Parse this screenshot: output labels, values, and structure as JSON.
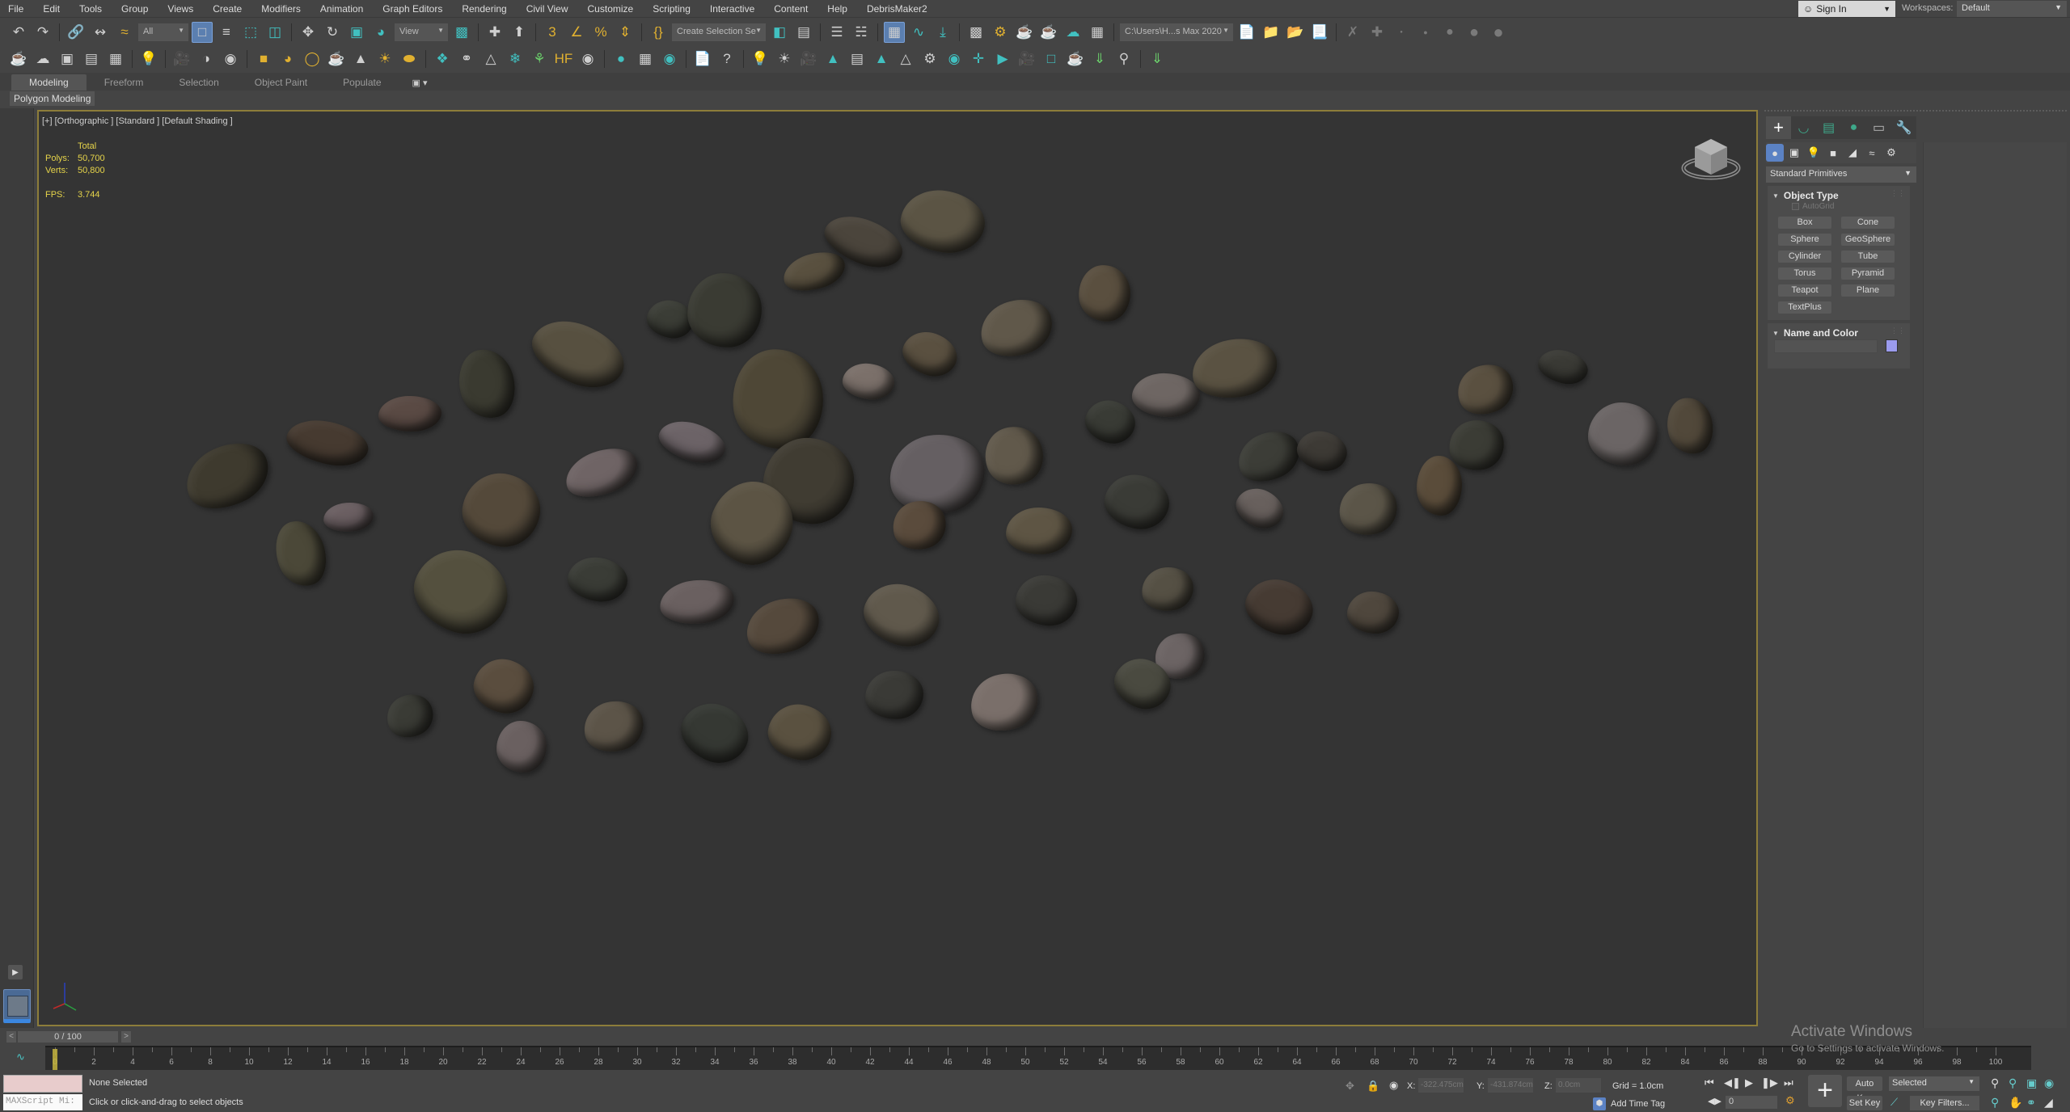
{
  "menubar": {
    "items": [
      "File",
      "Edit",
      "Tools",
      "Group",
      "Views",
      "Create",
      "Modifiers",
      "Animation",
      "Graph Editors",
      "Rendering",
      "Civil View",
      "Customize",
      "Scripting",
      "Interactive",
      "Content",
      "Help",
      "DebrisMaker2"
    ],
    "sign_in": "Sign In",
    "workspaces_label": "Workspaces:",
    "workspace_value": "Default"
  },
  "toolbar": {
    "selection_filter": "All",
    "ref_coord": "View",
    "named_selection": "Create Selection Se",
    "project_path": "C:\\Users\\H...s Max 2020"
  },
  "ribbon": {
    "tabs": [
      "Modeling",
      "Freeform",
      "Selection",
      "Object Paint",
      "Populate"
    ],
    "active_tab": "Modeling",
    "sub_panel": "Polygon Modeling"
  },
  "viewport": {
    "label": "[+] [Orthographic ] [Standard ] [Default Shading ]",
    "stats": {
      "header": "Total",
      "polys_label": "Polys:",
      "polys": "50,700",
      "verts_label": "Verts:",
      "verts": "50,800",
      "fps_label": "FPS:",
      "fps": "3.744"
    },
    "colors": {
      "frame": "#8d7d3a",
      "stats": "#e6d44a"
    }
  },
  "command_panel": {
    "category": "Standard Primitives",
    "object_type": {
      "title": "Object Type",
      "autogrid": "AutoGrid",
      "buttons": [
        "Box",
        "Cone",
        "Sphere",
        "GeoSphere",
        "Cylinder",
        "Tube",
        "Torus",
        "Pyramid",
        "Teapot",
        "Plane",
        "TextPlus"
      ]
    },
    "name_color": {
      "title": "Name and Color",
      "name_value": "",
      "swatch_color": "#9b9bee"
    }
  },
  "timeline": {
    "slider_text": "0 / 100",
    "current_frame": 0,
    "start": 0,
    "end": 100,
    "label_step": 2
  },
  "statusbar": {
    "maxscript_placeholder": "MAXScript Mi:",
    "selection_status": "None Selected",
    "prompt": "Click or click-and-drag to select objects",
    "x_label": "X:",
    "x_value": "-322.475cm",
    "y_label": "Y:",
    "y_value": "-431.874cm",
    "z_label": "Z:",
    "z_value": "0.0cm",
    "grid": "Grid = 1.0cm",
    "add_time_tag": "Add Time Tag",
    "frame_value": "0",
    "auto_key": "Auto Key",
    "set_key": "Set Key",
    "key_mode": "Selected",
    "key_filters": "Key Filters..."
  },
  "watermark": {
    "title": "Activate Windows",
    "subtitle": "Go to Settings to activate Windows."
  }
}
